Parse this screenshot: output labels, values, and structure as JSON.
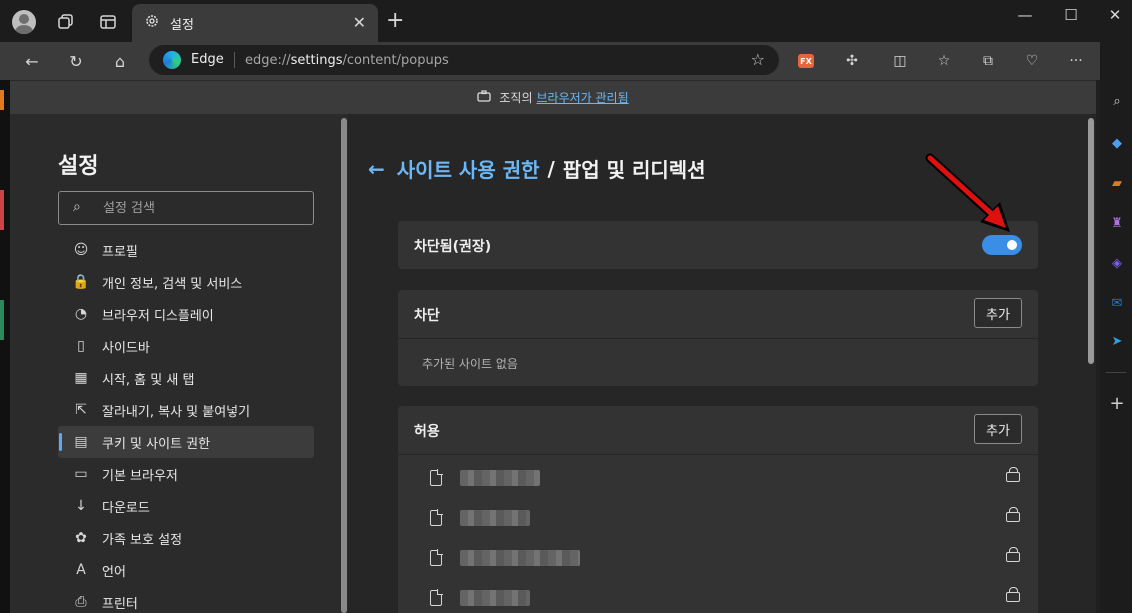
{
  "tab": {
    "title": "설정",
    "close_label": "✕"
  },
  "window": {
    "minimize": "—",
    "maximize": "☐",
    "close": "✕",
    "new_tab": "+"
  },
  "address": {
    "site_label": "Edge",
    "url_prefix": "edge://",
    "url_bold": "settings",
    "url_rest": "/content/popups"
  },
  "banner": {
    "text": "조직의",
    "link": "브라우저가 관리됨"
  },
  "sidebar": {
    "title": "설정",
    "search_placeholder": "설정 검색",
    "items": [
      {
        "label": "프로필",
        "icon": "profile-icon",
        "glyph": "☺"
      },
      {
        "label": "개인 정보, 검색 및 서비스",
        "icon": "lock-icon",
        "glyph": "🔒"
      },
      {
        "label": "브라우저 디스플레이",
        "icon": "palette-icon",
        "glyph": "◔"
      },
      {
        "label": "사이드바",
        "icon": "sidebar-icon",
        "glyph": "▯"
      },
      {
        "label": "시작, 홈 및 새 탭",
        "icon": "home-grid-icon",
        "glyph": "▦"
      },
      {
        "label": "잘라내기, 복사 및 붙여넣기",
        "icon": "share-icon",
        "glyph": "⇱"
      },
      {
        "label": "쿠키 및 사이트 권한",
        "icon": "cookie-site-icon",
        "glyph": "▤",
        "active": true
      },
      {
        "label": "기본 브라우저",
        "icon": "default-browser-icon",
        "glyph": "▭"
      },
      {
        "label": "다운로드",
        "icon": "download-icon",
        "glyph": "↓"
      },
      {
        "label": "가족 보호 설정",
        "icon": "family-icon",
        "glyph": "✿"
      },
      {
        "label": "언어",
        "icon": "language-icon",
        "glyph": "A"
      },
      {
        "label": "프린터",
        "icon": "printer-icon",
        "glyph": "⎙"
      }
    ]
  },
  "main": {
    "breadcrumb_parent": "사이트 사용 권한",
    "breadcrumb_sep": "/",
    "breadcrumb_current": "팝업 및 리디렉션",
    "blocked_toggle_label": "차단됨(권장)",
    "blocked_toggle_on": true,
    "block_section": {
      "title": "차단",
      "add_label": "추가",
      "empty_text": "추가된 사이트 없음"
    },
    "allow_section": {
      "title": "허용",
      "add_label": "추가"
    }
  },
  "colors": {
    "accent": "#6cb8f6",
    "toggle_on": "#3a8ee6",
    "arrow": "#e01010"
  }
}
